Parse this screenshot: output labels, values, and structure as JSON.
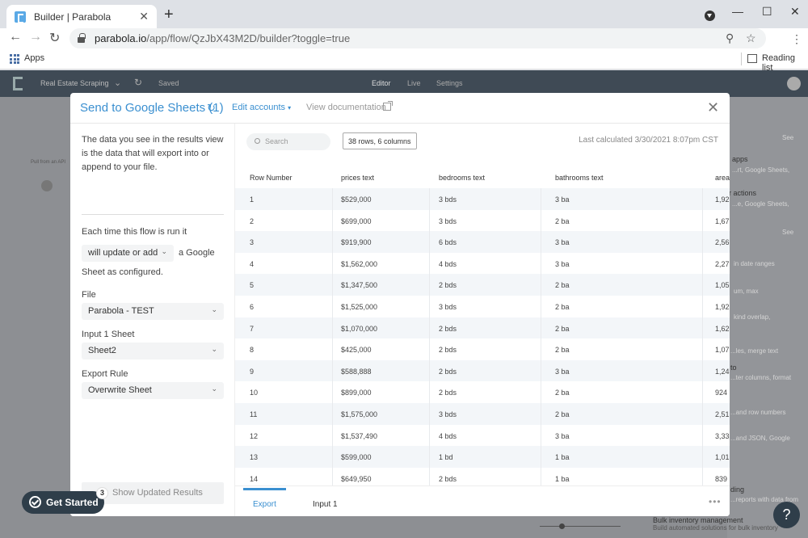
{
  "browser": {
    "tab_title": "Builder | Parabola",
    "tab_close": "✕",
    "new_tab": "+",
    "url_host": "parabola.io",
    "url_path": "/app/flow/QzJbX43M2D/builder?toggle=true",
    "bookmarks": {
      "apps": "Apps",
      "reading_list": "Reading list"
    }
  },
  "app": {
    "flow_name": "Real Estate Scraping",
    "saved": "Saved",
    "nav": {
      "editor": "Editor",
      "live": "Live",
      "settings": "Settings"
    },
    "left_card_label": "Pull from an API",
    "right_panel": {
      "see1": "See",
      "apps": "apps",
      "apps_sub": "...rt, Google Sheets,",
      "actions": "r actions",
      "actions_sub": "...e, Google Sheets,",
      "see2": "See",
      "date_ranges": "in date ranges",
      "min_max": "um, max",
      "overlap": "kind overlap,",
      "merge_text": "...les, merge text",
      "to": "to",
      "filter_cols": "...ter columns, format",
      "row_numbers": "...and row numbers",
      "json": "...and JSON, Google",
      "ding": "ding",
      "reports": "...reports with data from",
      "bulk_title": "Bulk inventory management",
      "bulk_sub": "Build automated solutions for bulk inventory"
    }
  },
  "modal": {
    "title": "Send to Google Sheets (1)",
    "edit_accounts": "Edit accounts",
    "view_documentation": "View documentation",
    "sidebar": {
      "intro": "The data you see in the results view is the data that will export into or append to your file.",
      "each_time": "Each time this flow is run it",
      "mode_value": "will update or add",
      "mode_suffix": "a Google",
      "mode_suffix2": "Sheet as configured.",
      "file_label": "File",
      "file_value": "Parabola - TEST",
      "sheet_label": "Input 1 Sheet",
      "sheet_value": "Sheet2",
      "rule_label": "Export Rule",
      "rule_value": "Overwrite Sheet",
      "show_updated": "Show Updated Results"
    },
    "toolbar": {
      "search_placeholder": "Search",
      "rows_badge": "38 rows, 6 columns",
      "last_calculated": "Last calculated 3/30/2021 8:07pm CST"
    },
    "table": {
      "columns": [
        "Row Number",
        "prices text",
        "bedrooms text",
        "bathrooms text",
        "area"
      ],
      "rows": [
        [
          "1",
          "$529,000",
          "3 bds",
          "3 ba",
          "1,92"
        ],
        [
          "2",
          "$699,000",
          "3 bds",
          "2 ba",
          "1,67"
        ],
        [
          "3",
          "$919,900",
          "6 bds",
          "3 ba",
          "2,56"
        ],
        [
          "4",
          "$1,562,000",
          "4 bds",
          "3 ba",
          "2,27"
        ],
        [
          "5",
          "$1,347,500",
          "2 bds",
          "2 ba",
          "1,05"
        ],
        [
          "6",
          "$1,525,000",
          "3 bds",
          "2 ba",
          "1,92"
        ],
        [
          "7",
          "$1,070,000",
          "2 bds",
          "2 ba",
          "1,62"
        ],
        [
          "8",
          "$425,000",
          "2 bds",
          "2 ba",
          "1,07"
        ],
        [
          "9",
          "$588,888",
          "2 bds",
          "3 ba",
          "1,24"
        ],
        [
          "10",
          "$899,000",
          "2 bds",
          "2 ba",
          "924"
        ],
        [
          "11",
          "$1,575,000",
          "3 bds",
          "2 ba",
          "2,51"
        ],
        [
          "12",
          "$1,537,490",
          "4 bds",
          "3 ba",
          "3,33"
        ],
        [
          "13",
          "$599,000",
          "1 bd",
          "1 ba",
          "1,01"
        ],
        [
          "14",
          "$649,950",
          "2 bds",
          "1 ba",
          "839"
        ]
      ]
    },
    "footer_tabs": {
      "export": "Export",
      "input": "Input 1"
    }
  },
  "onboarding": {
    "get_started": "Get Started",
    "badge_count": "3"
  },
  "help": "?"
}
